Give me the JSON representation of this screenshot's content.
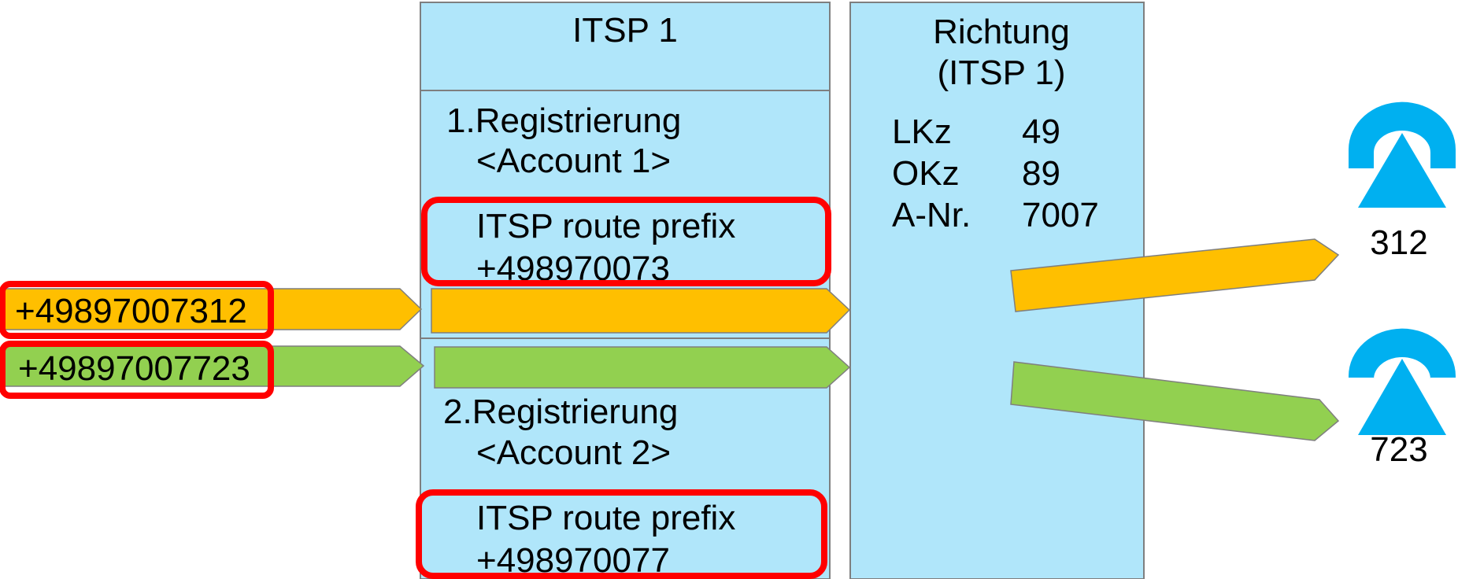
{
  "itsp_box": {
    "title": "ITSP 1",
    "registration1": {
      "line1": "1.Registrierung",
      "line2": "<Account 1>"
    },
    "prefix1": {
      "label": "ITSP route prefix",
      "value": "+498970073"
    },
    "registration2": {
      "line1": "2.Registrierung",
      "line2": "<Account 2>"
    },
    "prefix2": {
      "label": "ITSP route prefix",
      "value": "+498970077"
    }
  },
  "direction_box": {
    "title_line1": "Richtung",
    "title_line2": "(ITSP 1)",
    "rows": [
      {
        "key": "LKz",
        "value": "49"
      },
      {
        "key": "OKz",
        "value": "89"
      },
      {
        "key": "A-Nr.",
        "value": "7007"
      }
    ]
  },
  "incoming_calls": [
    {
      "number": "+49897007312",
      "color": "#FFBF00"
    },
    {
      "number": "+49897007723",
      "color": "#92D050"
    }
  ],
  "extensions": [
    {
      "number": "312",
      "icon": "telephone-icon"
    },
    {
      "number": "723",
      "icon": "telephone-icon"
    }
  ],
  "colors": {
    "box_fill": "#B0E6FA",
    "highlight": "#FF0000",
    "phone": "#00B0F0"
  }
}
